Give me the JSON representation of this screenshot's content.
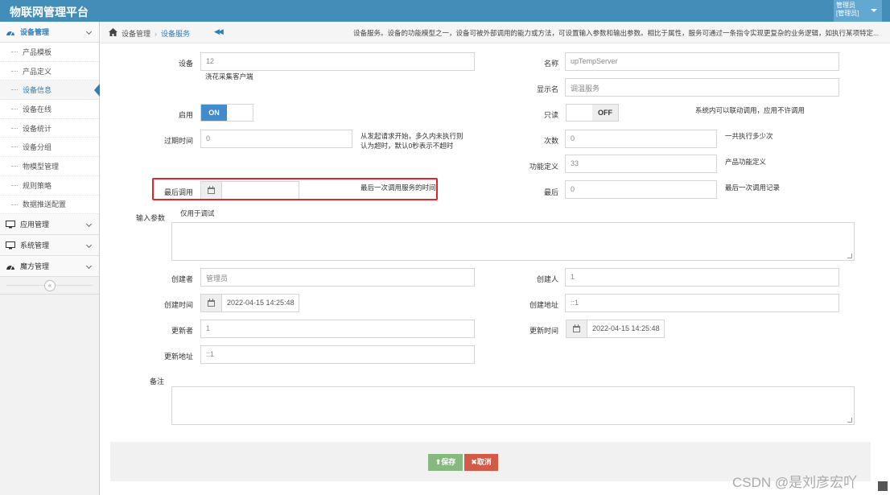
{
  "app": {
    "title": "物联网管理平台",
    "user_line1": "管理员",
    "user_line2": "[管理员]"
  },
  "sidebar": {
    "device_mgmt": "设备管理",
    "sub_items": [
      "产品模板",
      "产品定义",
      "设备信息",
      "设备在线",
      "设备统计",
      "设备分组",
      "物模型管理",
      "规则策略",
      "数据推送配置"
    ],
    "app_mgmt": "应用管理",
    "sys_mgmt": "系统管理",
    "magic_mgmt": "魔方管理",
    "collapse_icon": "«"
  },
  "breadcrumb": {
    "home": "设备管理",
    "current": "设备服务",
    "back_icon": "◀◀",
    "description": "设备服务。设备的功能模型之一，设备可被外部调用的能力或方法，可设置输入参数和输出参数。相比于属性，服务可通过一条指令实现更复杂的业务逻辑，如执行某项特定..."
  },
  "form": {
    "device_label": "设备",
    "device_value": "12",
    "device_note": "浇花采集客户端",
    "name_label": "名称",
    "name_value": "upTempServer",
    "display_label": "显示名",
    "display_value": "调温服务",
    "enable_label": "启用",
    "enable_on": "ON",
    "readonly_label": "只读",
    "readonly_off": "OFF",
    "readonly_note": "系统内可以联动调用，应用不许调用",
    "expire_label": "过期时间",
    "expire_value": "0",
    "expire_note": "从发起请求开始，多久内未执行则认为超时，默认0秒表示不超时",
    "count_label": "次数",
    "count_value": "0",
    "count_note": "一共执行多少次",
    "func_label": "功能定义",
    "func_value": "33",
    "func_note": "产品功能定义",
    "last_call_label": "最后调用",
    "last_call_value": "",
    "last_call_note": "最后一次调用服务的时间",
    "last_label": "最后",
    "last_value": "0",
    "last_note": "最后一次调用记录",
    "input_label": "输入参数",
    "input_note": "仅用于调试",
    "creator_label": "创建者",
    "creator_value": "管理员",
    "creator_user_label": "创建人",
    "creator_user_value": "1",
    "create_time_label": "创建时间",
    "create_time_value": "2022-04-15 14:25:48",
    "create_addr_label": "创建地址",
    "create_addr_value": "::1",
    "updater_label": "更新者",
    "updater_value": "1",
    "update_time_label": "更新时间",
    "update_time_value": "2022-04-15 14:25:48",
    "update_addr_label": "更新地址",
    "update_addr_value": "::1",
    "remark_label": "备注"
  },
  "buttons": {
    "save": "⬆保存",
    "cancel": "✖取消"
  },
  "watermark": "CSDN @是刘彦宏吖"
}
